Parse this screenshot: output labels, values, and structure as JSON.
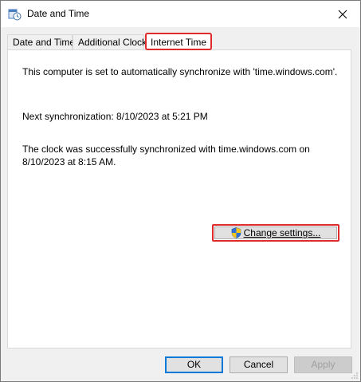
{
  "window": {
    "title": "Date and Time"
  },
  "tabs": [
    {
      "label": "Date and Time"
    },
    {
      "label": "Additional Clocks"
    },
    {
      "label": "Internet Time",
      "active": true
    }
  ],
  "panel": {
    "sync_info": "This computer is set to automatically synchronize with 'time.windows.com'.",
    "next_sync": "Next synchronization: 8/10/2023 at 5:21 PM",
    "last_sync": "The clock was successfully synchronized with time.windows.com on 8/10/2023 at 8:15 AM.",
    "change_settings_label": "Change settings..."
  },
  "buttons": {
    "ok": "OK",
    "cancel": "Cancel",
    "apply": "Apply"
  },
  "icons": {
    "app": "date-time-icon",
    "close": "close-icon",
    "uac": "uac-shield-icon"
  },
  "colors": {
    "highlight": "#e12a2a",
    "focus": "#0078d7"
  }
}
